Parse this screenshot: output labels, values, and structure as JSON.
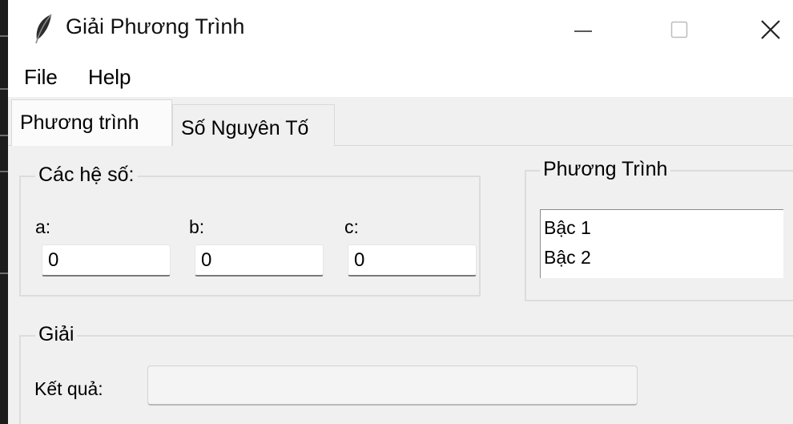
{
  "window": {
    "title": "Giải Phương Trình",
    "icon": "feather-icon"
  },
  "menu": [
    {
      "label": "File"
    },
    {
      "label": "Help"
    }
  ],
  "tabs": [
    {
      "label": "Phương trình",
      "active": true
    },
    {
      "label": "Số Nguyên Tố",
      "active": false
    }
  ],
  "coefficients": {
    "group_title": "Các hệ số:",
    "a": {
      "label": "a:",
      "value": "0"
    },
    "b": {
      "label": "b:",
      "value": "0"
    },
    "c": {
      "label": "c:",
      "value": "0"
    }
  },
  "equation": {
    "group_title": "Phương Trình",
    "items": [
      "Bậc 1",
      "Bậc 2"
    ]
  },
  "solve": {
    "group_title": "Giải",
    "result_label": "Kết quả:",
    "result_value": ""
  }
}
